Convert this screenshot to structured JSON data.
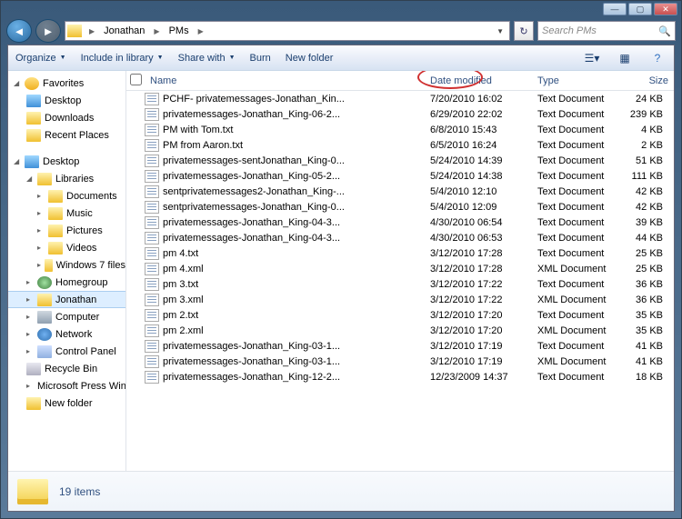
{
  "breadcrumb": {
    "seg1": "Jonathan",
    "seg2": "PMs"
  },
  "search": {
    "placeholder": "Search PMs"
  },
  "toolbar": {
    "organize": "Organize",
    "include": "Include in library",
    "share": "Share with",
    "burn": "Burn",
    "newfolder": "New folder"
  },
  "columns": {
    "name": "Name",
    "date": "Date modified",
    "type": "Type",
    "size": "Size"
  },
  "sidebar": {
    "favorites": "Favorites",
    "desktop": "Desktop",
    "downloads": "Downloads",
    "recent": "Recent Places",
    "desktop2": "Desktop",
    "libraries": "Libraries",
    "documents": "Documents",
    "music": "Music",
    "pictures": "Pictures",
    "videos": "Videos",
    "win7": "Windows 7 files",
    "homegroup": "Homegroup",
    "jonathan": "Jonathan",
    "computer": "Computer",
    "network": "Network",
    "controlpanel": "Control Panel",
    "recycle": "Recycle Bin",
    "mswin": "Microsoft Press Win",
    "newfolder": "New folder"
  },
  "files": [
    {
      "name": "PCHF- privatemessages-Jonathan_Kin...",
      "date": "7/20/2010 16:02",
      "type": "Text Document",
      "size": "24 KB"
    },
    {
      "name": "privatemessages-Jonathan_King-06-2...",
      "date": "6/29/2010 22:02",
      "type": "Text Document",
      "size": "239 KB"
    },
    {
      "name": "PM with Tom.txt",
      "date": "6/8/2010 15:43",
      "type": "Text Document",
      "size": "4 KB"
    },
    {
      "name": "PM from Aaron.txt",
      "date": "6/5/2010 16:24",
      "type": "Text Document",
      "size": "2 KB"
    },
    {
      "name": "privatemessages-sentJonathan_King-0...",
      "date": "5/24/2010 14:39",
      "type": "Text Document",
      "size": "51 KB"
    },
    {
      "name": "privatemessages-Jonathan_King-05-2...",
      "date": "5/24/2010 14:38",
      "type": "Text Document",
      "size": "111 KB"
    },
    {
      "name": "sentprivatemessages2-Jonathan_King-...",
      "date": "5/4/2010 12:10",
      "type": "Text Document",
      "size": "42 KB"
    },
    {
      "name": "sentprivatemessages-Jonathan_King-0...",
      "date": "5/4/2010 12:09",
      "type": "Text Document",
      "size": "42 KB"
    },
    {
      "name": "privatemessages-Jonathan_King-04-3...",
      "date": "4/30/2010 06:54",
      "type": "Text Document",
      "size": "39 KB"
    },
    {
      "name": "privatemessages-Jonathan_King-04-3...",
      "date": "4/30/2010 06:53",
      "type": "Text Document",
      "size": "44 KB"
    },
    {
      "name": "pm 4.txt",
      "date": "3/12/2010 17:28",
      "type": "Text Document",
      "size": "25 KB"
    },
    {
      "name": "pm 4.xml",
      "date": "3/12/2010 17:28",
      "type": "XML Document",
      "size": "25 KB"
    },
    {
      "name": "pm 3.txt",
      "date": "3/12/2010 17:22",
      "type": "Text Document",
      "size": "36 KB"
    },
    {
      "name": "pm 3.xml",
      "date": "3/12/2010 17:22",
      "type": "XML Document",
      "size": "36 KB"
    },
    {
      "name": "pm 2.txt",
      "date": "3/12/2010 17:20",
      "type": "Text Document",
      "size": "35 KB"
    },
    {
      "name": "pm 2.xml",
      "date": "3/12/2010 17:20",
      "type": "XML Document",
      "size": "35 KB"
    },
    {
      "name": "privatemessages-Jonathan_King-03-1...",
      "date": "3/12/2010 17:19",
      "type": "Text Document",
      "size": "41 KB"
    },
    {
      "name": "privatemessages-Jonathan_King-03-1...",
      "date": "3/12/2010 17:19",
      "type": "XML Document",
      "size": "41 KB"
    },
    {
      "name": "privatemessages-Jonathan_King-12-2...",
      "date": "12/23/2009 14:37",
      "type": "Text Document",
      "size": "18 KB"
    }
  ],
  "status": {
    "text": "19 items"
  }
}
